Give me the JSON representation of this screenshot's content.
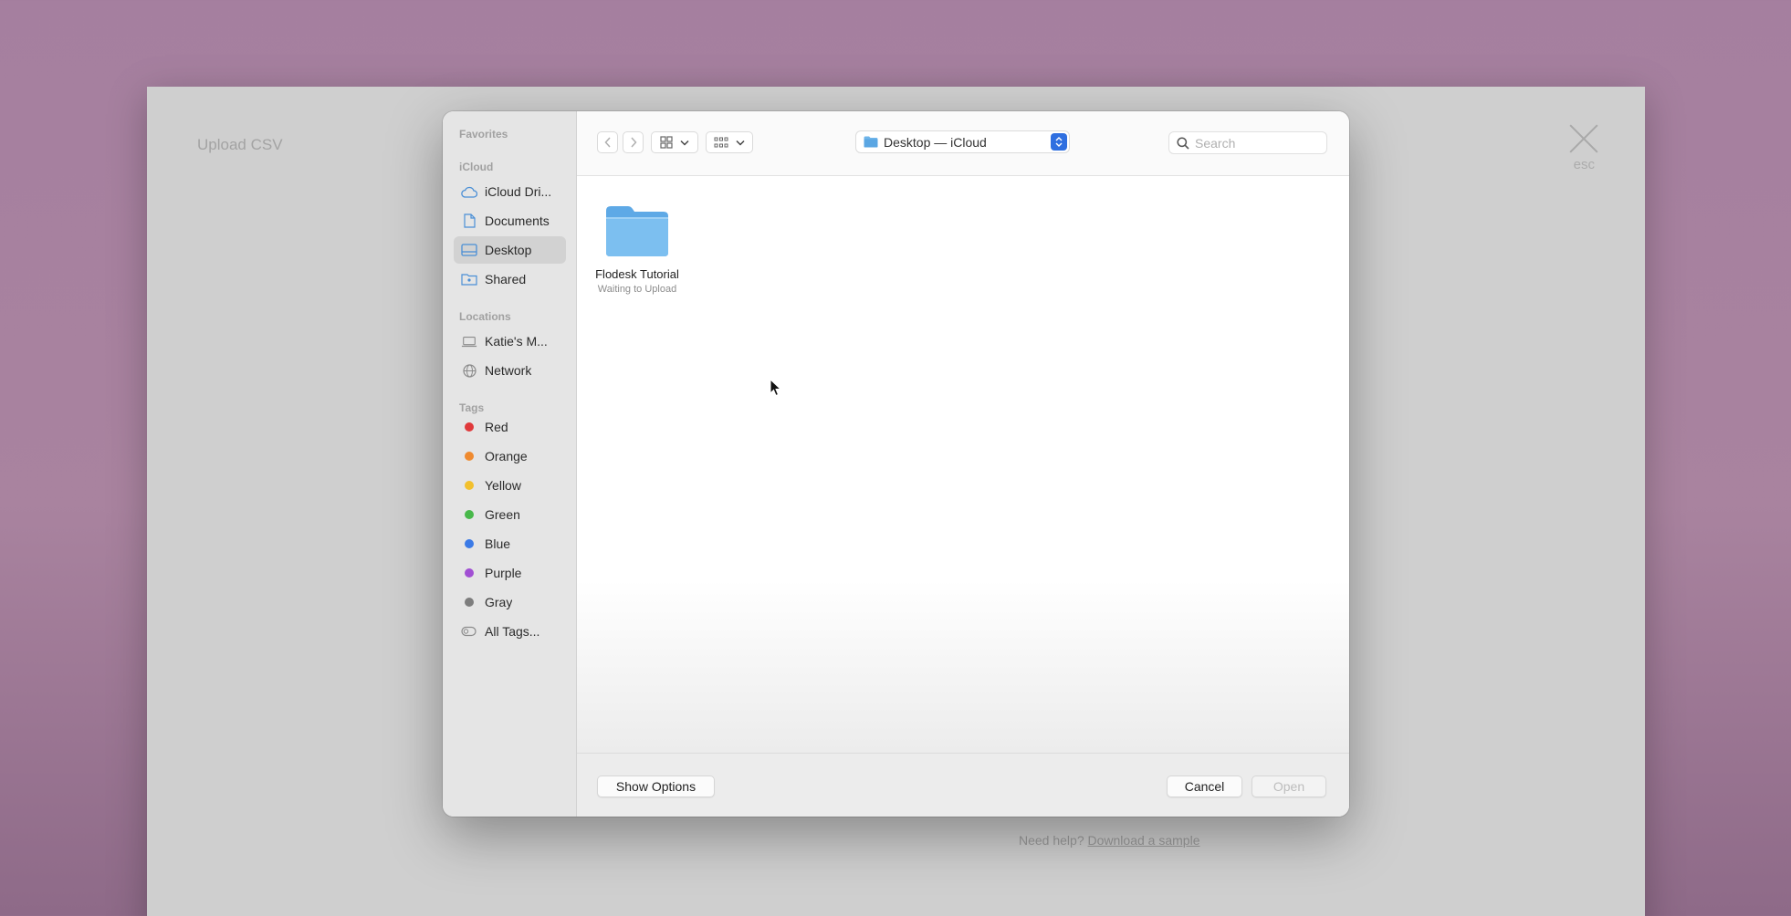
{
  "background": {
    "title": "Upload CSV",
    "esc_label": "esc",
    "help_text": "Need help?",
    "help_link": "Download a sample"
  },
  "dialog": {
    "sidebar": {
      "favorites_header": "Favorites",
      "icloud_header": "iCloud",
      "icloud_items": [
        {
          "label": "iCloud Dri...",
          "icon": "cloud-icon"
        },
        {
          "label": "Documents",
          "icon": "document-icon"
        },
        {
          "label": "Desktop",
          "icon": "desktop-icon",
          "selected": true
        },
        {
          "label": "Shared",
          "icon": "shared-folder-icon"
        }
      ],
      "locations_header": "Locations",
      "location_items": [
        {
          "label": "Katie's M...",
          "icon": "laptop-icon"
        },
        {
          "label": "Network",
          "icon": "globe-icon"
        }
      ],
      "tags_header": "Tags",
      "tags": [
        {
          "label": "Red",
          "color": "#e0393b"
        },
        {
          "label": "Orange",
          "color": "#ef8a2f"
        },
        {
          "label": "Yellow",
          "color": "#f2c02d"
        },
        {
          "label": "Green",
          "color": "#48b84a"
        },
        {
          "label": "Blue",
          "color": "#3b7ae6"
        },
        {
          "label": "Purple",
          "color": "#a14fd3"
        },
        {
          "label": "Gray",
          "color": "#7d7d7d"
        }
      ],
      "all_tags": "All Tags..."
    },
    "toolbar": {
      "location": "Desktop — iCloud",
      "search_placeholder": "Search"
    },
    "files": [
      {
        "name": "Flodesk Tutorial",
        "status": "Waiting to Upload"
      }
    ],
    "footer": {
      "show_options": "Show Options",
      "cancel": "Cancel",
      "open": "Open"
    },
    "colors": {
      "accent": "#2f6fe0",
      "folder": "#6fb5ea"
    }
  }
}
